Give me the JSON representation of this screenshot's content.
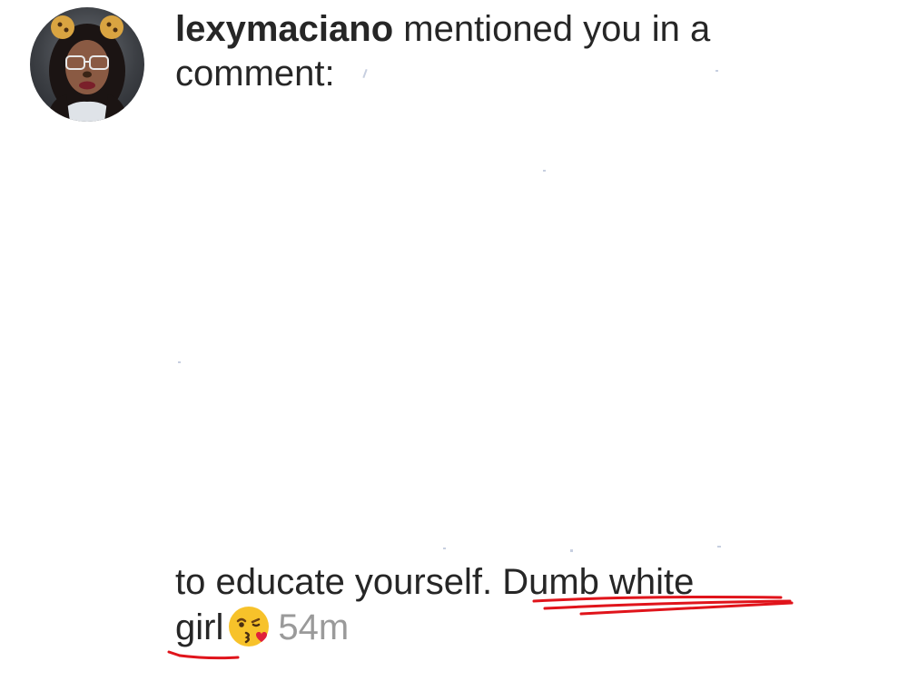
{
  "notification": {
    "username": "lexymaciano",
    "message": " mentioned you in a comment: ",
    "comment_tail_text": "to educate yourself. ",
    "comment_highlight_1": "Dumb white",
    "comment_highlight_2": "girl",
    "emoji": "kissing-face-with-heart-emoji",
    "timestamp": "54m"
  },
  "colors": {
    "text": "#262626",
    "timestamp": "#9a9a9a",
    "underline": "#e0141b"
  }
}
